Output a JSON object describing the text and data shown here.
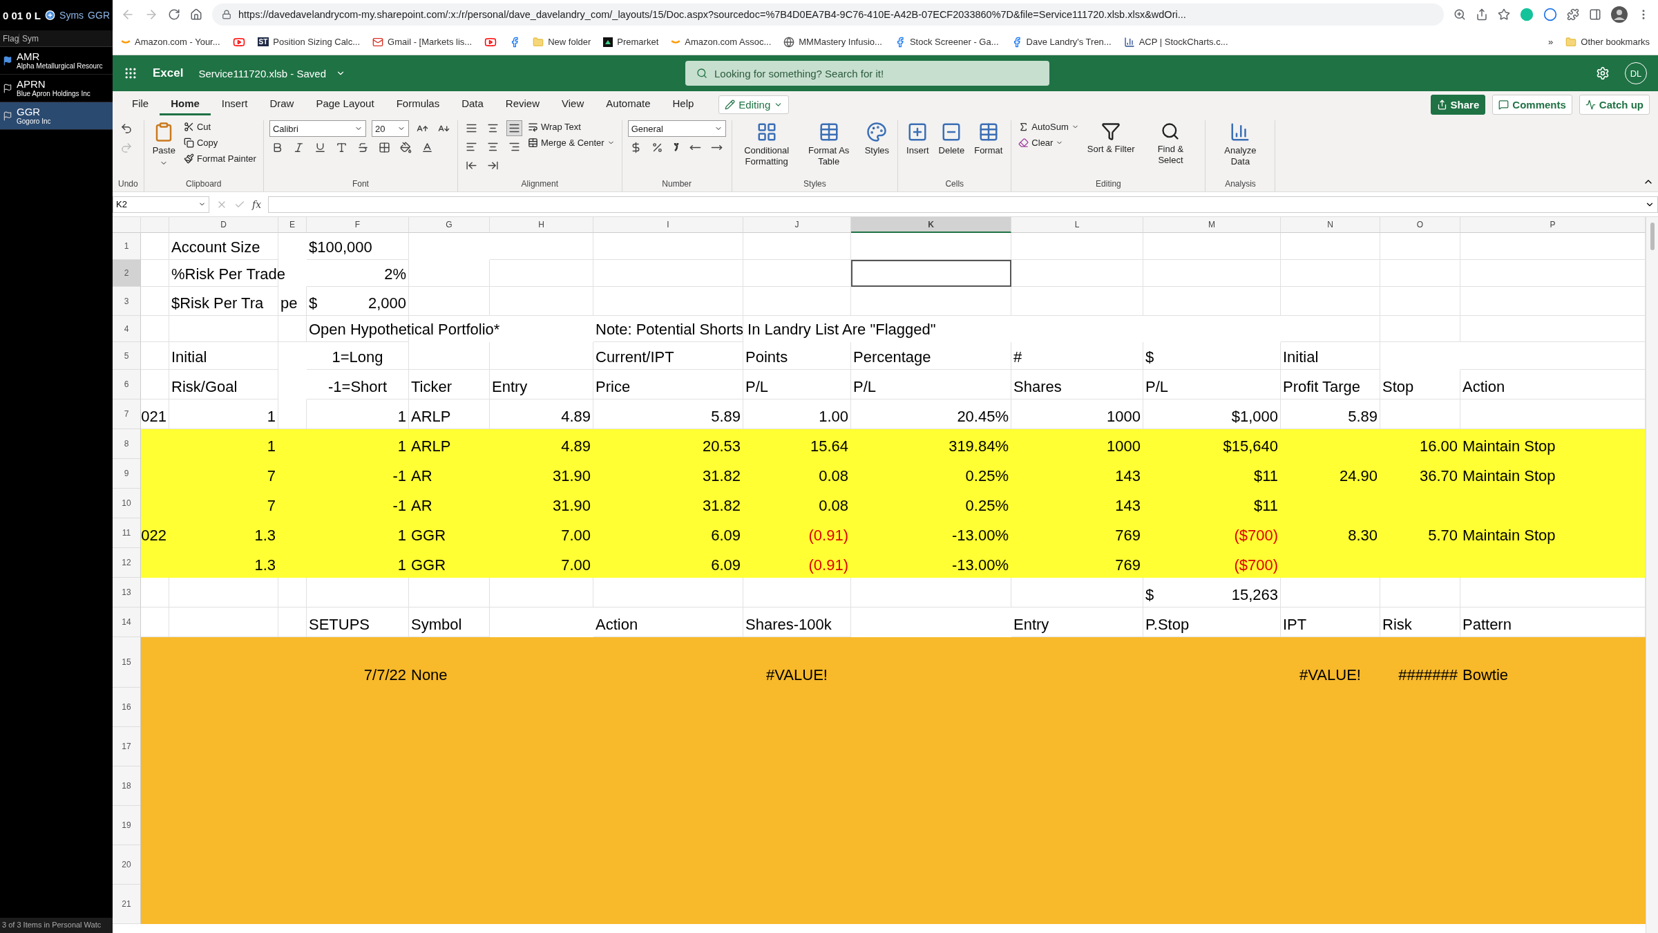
{
  "watchlist": {
    "top": "0 01 0 L",
    "syms": "Syms",
    "symbol": "GGR",
    "columns": [
      "Flag",
      "Sym"
    ],
    "items": [
      {
        "symbol": "AMR",
        "name": "Alpha Metallurgical Resourc",
        "flagged": true,
        "selected": false
      },
      {
        "symbol": "APRN",
        "name": "Blue Apron Holdings Inc",
        "flagged": false,
        "selected": false
      },
      {
        "symbol": "GGR",
        "name": "Gogoro Inc",
        "flagged": false,
        "selected": true
      }
    ],
    "footer": "3 of 3 Items in Personal Watc"
  },
  "browser": {
    "url": "https://davedavelandrycom-my.sharepoint.com/:x:/r/personal/dave_davelandry_com/_layouts/15/Doc.aspx?sourcedoc=%7B4D0EA7B4-9C76-410E-A42B-07ECF2033860%7D&file=Service111720.xlsb.xlsx&wdOri...",
    "bookmarks": [
      {
        "kind": "amazon",
        "label": "Amazon.com - Your..."
      },
      {
        "kind": "youtube"
      },
      {
        "kind": "badge",
        "badge": "ST",
        "label": "Position Sizing Calc..."
      },
      {
        "kind": "gmail",
        "label": "Gmail - [Markets lis..."
      },
      {
        "kind": "youtube"
      },
      {
        "kind": "facebook"
      },
      {
        "kind": "folder",
        "label": "New folder"
      },
      {
        "kind": "triangle",
        "label": "Premarket"
      },
      {
        "kind": "amazon",
        "label": "Amazon.com Assoc..."
      },
      {
        "kind": "wordpress",
        "label": "MMMastery Infusio..."
      },
      {
        "kind": "facebook",
        "label": "Stock Screener - Ga..."
      },
      {
        "kind": "facebook",
        "label": "Dave Landry's Tren..."
      },
      {
        "kind": "chart",
        "label": "ACP | StockCharts.c..."
      }
    ],
    "more": "»",
    "other": "Other bookmarks"
  },
  "excel": {
    "app": "Excel",
    "file": "Service111720.xlsb - Saved",
    "search_placeholder": "Looking for something? Search for it!",
    "avatar": "DL"
  },
  "tabs": [
    {
      "label": "File",
      "selected": false
    },
    {
      "label": "Home",
      "selected": true
    },
    {
      "label": "Insert",
      "selected": false
    },
    {
      "label": "Draw",
      "selected": false
    },
    {
      "label": "Page Layout",
      "selected": false
    },
    {
      "label": "Formulas",
      "selected": false
    },
    {
      "label": "Data",
      "selected": false
    },
    {
      "label": "Review",
      "selected": false
    },
    {
      "label": "View",
      "selected": false
    },
    {
      "label": "Automate",
      "selected": false
    },
    {
      "label": "Help",
      "selected": false
    }
  ],
  "mode": "Editing",
  "actions": [
    "Share",
    "Comments",
    "Catch up"
  ],
  "ribbon": [
    {
      "kind": "undo",
      "label": "Undo",
      "undo_disabled": false,
      "redo_disabled": true
    },
    {
      "kind": "clipboard",
      "label": "Clipboard",
      "paste": "Paste",
      "actions": [
        "Cut",
        "Copy",
        "Format Painter"
      ]
    },
    {
      "kind": "font",
      "label": "Font",
      "font": "Calibri",
      "size": "20"
    },
    {
      "kind": "alignment",
      "label": "Alignment",
      "wrap": "Wrap Text",
      "merge": "Merge & Center"
    },
    {
      "kind": "number",
      "label": "Number",
      "format": "General"
    },
    {
      "kind": "styles",
      "label": "Styles",
      "buttons": [
        "Conditional Formatting",
        "Format As Table",
        "Styles"
      ]
    },
    {
      "kind": "cells",
      "label": "Cells",
      "buttons": [
        "Insert",
        "Delete",
        "Format"
      ]
    },
    {
      "kind": "editing",
      "label": "Editing",
      "small": [
        "AutoSum",
        "Clear"
      ],
      "buttons": [
        "Sort & Filter",
        "Find & Select"
      ]
    },
    {
      "kind": "analysis",
      "label": "Analysis",
      "buttons": [
        "Analyze Data"
      ]
    }
  ],
  "formula_bar": {
    "name_box": "K2",
    "function": "fx"
  },
  "sheet": {
    "columns": [
      {
        "label": "D",
        "selected": false
      },
      {
        "label": "E",
        "selected": false
      },
      {
        "label": "F",
        "selected": false
      },
      {
        "label": "G",
        "selected": false
      },
      {
        "label": "H",
        "selected": false
      },
      {
        "label": "I",
        "selected": false
      },
      {
        "label": "J",
        "selected": false
      },
      {
        "label": "K",
        "selected": true
      },
      {
        "label": "L",
        "selected": false
      },
      {
        "label": "M",
        "selected": false
      },
      {
        "label": "N",
        "selected": false
      },
      {
        "label": "O",
        "selected": false
      },
      {
        "label": "P",
        "selected": false
      }
    ],
    "rows": [
      {
        "header": {
          "label": "1",
          "selected": false
        },
        "cells": [
          {},
          {
            "kind": "text",
            "text": "Account Size"
          },
          {},
          {
            "kind": "text",
            "text": "$100,000"
          },
          {},
          {},
          {},
          {},
          {},
          {},
          {},
          {},
          {},
          {}
        ]
      },
      {
        "header": {
          "label": "2",
          "selected": true
        },
        "cells": [
          {},
          {
            "kind": "text",
            "text": "%Risk Per Trade"
          },
          {},
          {
            "kind": "number",
            "text": "2%"
          },
          {},
          {},
          {},
          {},
          {},
          {},
          {},
          {},
          {},
          {}
        ]
      },
      {
        "header": {
          "label": "3",
          "selected": false
        },
        "cells": [
          {},
          {
            "kind": "text",
            "text": "$Risk Per Tra"
          },
          {
            "kind": "text",
            "text": "pe"
          },
          {
            "kind": "accounting",
            "symbol": "$",
            "text": "2,000"
          },
          {},
          {},
          {},
          {},
          {},
          {},
          {},
          {},
          {},
          {}
        ]
      },
      {
        "header": {
          "label": "4",
          "selected": false
        },
        "cells": [
          {},
          {},
          {},
          {
            "kind": "text",
            "text": "Open Hypothetical Portfolio*"
          },
          {},
          {},
          {
            "kind": "text",
            "text": "Note: Potential Shorts In Landry List Are \"Flagged\""
          },
          {},
          {},
          {},
          {},
          {},
          {},
          {}
        ]
      },
      {
        "header": {
          "label": "5",
          "selected": false
        },
        "cells": [
          {},
          {
            "kind": "text",
            "text": "Initial"
          },
          {},
          {
            "kind": "label",
            "text": "1=Long"
          },
          {},
          {},
          {
            "kind": "text",
            "text": "Current/IPT"
          },
          {
            "kind": "text",
            "text": "Points"
          },
          {
            "kind": "text",
            "text": "Percentage"
          },
          {
            "kind": "text",
            "text": "#"
          },
          {
            "kind": "text",
            "text": "$"
          },
          {
            "kind": "text",
            "text": "Initial"
          },
          {},
          {}
        ]
      },
      {
        "header": {
          "label": "6",
          "selected": false
        },
        "cells": [
          {},
          {
            "kind": "text",
            "text": "Risk/Goal"
          },
          {},
          {
            "kind": "label",
            "text": "-1=Short"
          },
          {
            "kind": "text",
            "text": "Ticker"
          },
          {
            "kind": "text",
            "text": "Entry"
          },
          {
            "kind": "text",
            "text": "Price"
          },
          {
            "kind": "text",
            "text": "P/L"
          },
          {
            "kind": "text",
            "text": "P/L"
          },
          {
            "kind": "text",
            "text": "Shares"
          },
          {
            "kind": "text",
            "text": "P/L"
          },
          {
            "kind": "text",
            "text": "Profit Targe"
          },
          {
            "kind": "text",
            "text": "Stop"
          },
          {
            "kind": "text",
            "text": "Action"
          }
        ]
      },
      {
        "header": {
          "label": "7",
          "selected": false
        },
        "cells": [
          {
            "kind": "number",
            "text": "021"
          },
          {
            "kind": "number",
            "text": "1"
          },
          {},
          {
            "kind": "number",
            "text": "1"
          },
          {
            "kind": "text",
            "text": "ARLP"
          },
          {
            "kind": "number",
            "text": "4.89"
          },
          {
            "kind": "number",
            "text": "5.89"
          },
          {
            "kind": "number",
            "text": "1.00"
          },
          {
            "kind": "number",
            "text": "20.45%"
          },
          {
            "kind": "number",
            "text": "1000"
          },
          {
            "kind": "number",
            "text": "$1,000"
          },
          {
            "kind": "number",
            "text": "5.89"
          },
          {},
          {}
        ]
      },
      {
        "header": {
          "label": "8",
          "selected": false
        },
        "color": "#ffff33",
        "cells": [
          {},
          {
            "kind": "number",
            "text": "1"
          },
          {},
          {
            "kind": "number",
            "text": "1"
          },
          {
            "kind": "text",
            "text": "ARLP"
          },
          {
            "kind": "number",
            "text": "4.89"
          },
          {
            "kind": "number",
            "text": "20.53"
          },
          {
            "kind": "number",
            "text": "15.64"
          },
          {
            "kind": "number",
            "text": "319.84%"
          },
          {
            "kind": "number",
            "text": "1000"
          },
          {
            "kind": "number",
            "text": "$15,640"
          },
          {},
          {
            "kind": "number",
            "text": "16.00"
          },
          {
            "kind": "text",
            "text": "Maintain Stop"
          }
        ]
      },
      {
        "header": {
          "label": "9",
          "selected": false
        },
        "color": "#ffff33",
        "cells": [
          {},
          {
            "kind": "number",
            "text": "7"
          },
          {},
          {
            "kind": "number",
            "text": "-1"
          },
          {
            "kind": "text",
            "text": "AR"
          },
          {
            "kind": "number",
            "text": "31.90"
          },
          {
            "kind": "number",
            "text": "31.82"
          },
          {
            "kind": "number",
            "text": "0.08"
          },
          {
            "kind": "number",
            "text": "0.25%"
          },
          {
            "kind": "number",
            "text": "143"
          },
          {
            "kind": "number",
            "text": "$11"
          },
          {
            "kind": "number",
            "text": "24.90"
          },
          {
            "kind": "number",
            "text": "36.70"
          },
          {
            "kind": "text",
            "text": "Maintain Stop"
          }
        ]
      },
      {
        "header": {
          "label": "10",
          "selected": false
        },
        "color": "#ffff33",
        "cells": [
          {},
          {
            "kind": "number",
            "text": "7"
          },
          {},
          {
            "kind": "number",
            "text": "-1"
          },
          {
            "kind": "text",
            "text": "AR"
          },
          {
            "kind": "number",
            "text": "31.90"
          },
          {
            "kind": "number",
            "text": "31.82"
          },
          {
            "kind": "number",
            "text": "0.08"
          },
          {
            "kind": "number",
            "text": "0.25%"
          },
          {
            "kind": "number",
            "text": "143"
          },
          {
            "kind": "number",
            "text": "$11"
          },
          {},
          {},
          {}
        ]
      },
      {
        "header": {
          "label": "11",
          "selected": false
        },
        "color": "#ffff33",
        "cells": [
          {
            "kind": "number",
            "text": "022"
          },
          {
            "kind": "number",
            "text": "1.3"
          },
          {},
          {
            "kind": "number",
            "text": "1"
          },
          {
            "kind": "text",
            "text": "GGR"
          },
          {
            "kind": "number",
            "text": "7.00"
          },
          {
            "kind": "number",
            "text": "6.09"
          },
          {
            "kind": "number",
            "text": "(0.91)",
            "color": "#e00000"
          },
          {
            "kind": "number",
            "text": "-13.00%"
          },
          {
            "kind": "number",
            "text": "769"
          },
          {
            "kind": "number",
            "text": "($700)",
            "color": "#e00000"
          },
          {
            "kind": "number",
            "text": "8.30"
          },
          {
            "kind": "number",
            "text": "5.70"
          },
          {
            "kind": "text",
            "text": "Maintain Stop"
          }
        ]
      },
      {
        "header": {
          "label": "12",
          "selected": false
        },
        "color": "#ffff33",
        "cells": [
          {},
          {
            "kind": "number",
            "text": "1.3"
          },
          {},
          {
            "kind": "number",
            "text": "1"
          },
          {
            "kind": "text",
            "text": "GGR"
          },
          {
            "kind": "number",
            "text": "7.00"
          },
          {
            "kind": "number",
            "text": "6.09"
          },
          {
            "kind": "number",
            "text": "(0.91)",
            "color": "#e00000"
          },
          {
            "kind": "number",
            "text": "-13.00%"
          },
          {
            "kind": "number",
            "text": "769"
          },
          {
            "kind": "number",
            "text": "($700)",
            "color": "#e00000"
          },
          {},
          {},
          {}
        ]
      },
      {
        "header": {
          "label": "13",
          "selected": false
        },
        "cells": [
          {},
          {},
          {},
          {},
          {},
          {},
          {},
          {},
          {},
          {},
          {
            "kind": "accounting",
            "symbol": "$",
            "text": "15,263"
          },
          {},
          {},
          {}
        ]
      },
      {
        "header": {
          "label": "14",
          "selected": false
        },
        "cells": [
          {},
          {},
          {},
          {
            "kind": "text",
            "text": "SETUPS"
          },
          {
            "kind": "text",
            "text": "Symbol"
          },
          {},
          {
            "kind": "text",
            "text": "Action"
          },
          {
            "kind": "text",
            "text": "Shares-100k"
          },
          {},
          {
            "kind": "text",
            "text": "Entry"
          },
          {
            "kind": "text",
            "text": "P.Stop"
          },
          {
            "kind": "text",
            "text": "IPT"
          },
          {
            "kind": "text",
            "text": "Risk"
          },
          {
            "kind": "text",
            "text": "Pattern"
          }
        ]
      },
      {
        "header": {
          "label": "15",
          "selected": false
        },
        "color": "#f8b92a",
        "cells": [
          {},
          {},
          {},
          {
            "kind": "number",
            "text": "7/7/22"
          },
          {
            "kind": "text",
            "text": "None"
          },
          {},
          {},
          {
            "kind": "error",
            "text": "#VALUE!"
          },
          {},
          {},
          {},
          {
            "kind": "error",
            "text": "#VALUE!"
          },
          {
            "kind": "number",
            "text": "#######"
          },
          {
            "kind": "text",
            "text": "Bowtie"
          }
        ]
      },
      {
        "header": {
          "label": "16",
          "selected": false
        },
        "color": "#f8b92a"
      },
      {
        "header": {
          "label": "17",
          "selected": false
        },
        "color": "#f8b92a"
      },
      {
        "header": {
          "label": "18",
          "selected": false
        },
        "color": "#f8b92a"
      },
      {
        "header": {
          "label": "19",
          "selected": false
        },
        "color": "#f8b92a"
      },
      {
        "header": {
          "label": "20",
          "selected": false
        },
        "color": "#f8b92a"
      },
      {
        "header": {
          "label": "21",
          "selected": false
        },
        "color": "#f8b92a"
      }
    ]
  }
}
